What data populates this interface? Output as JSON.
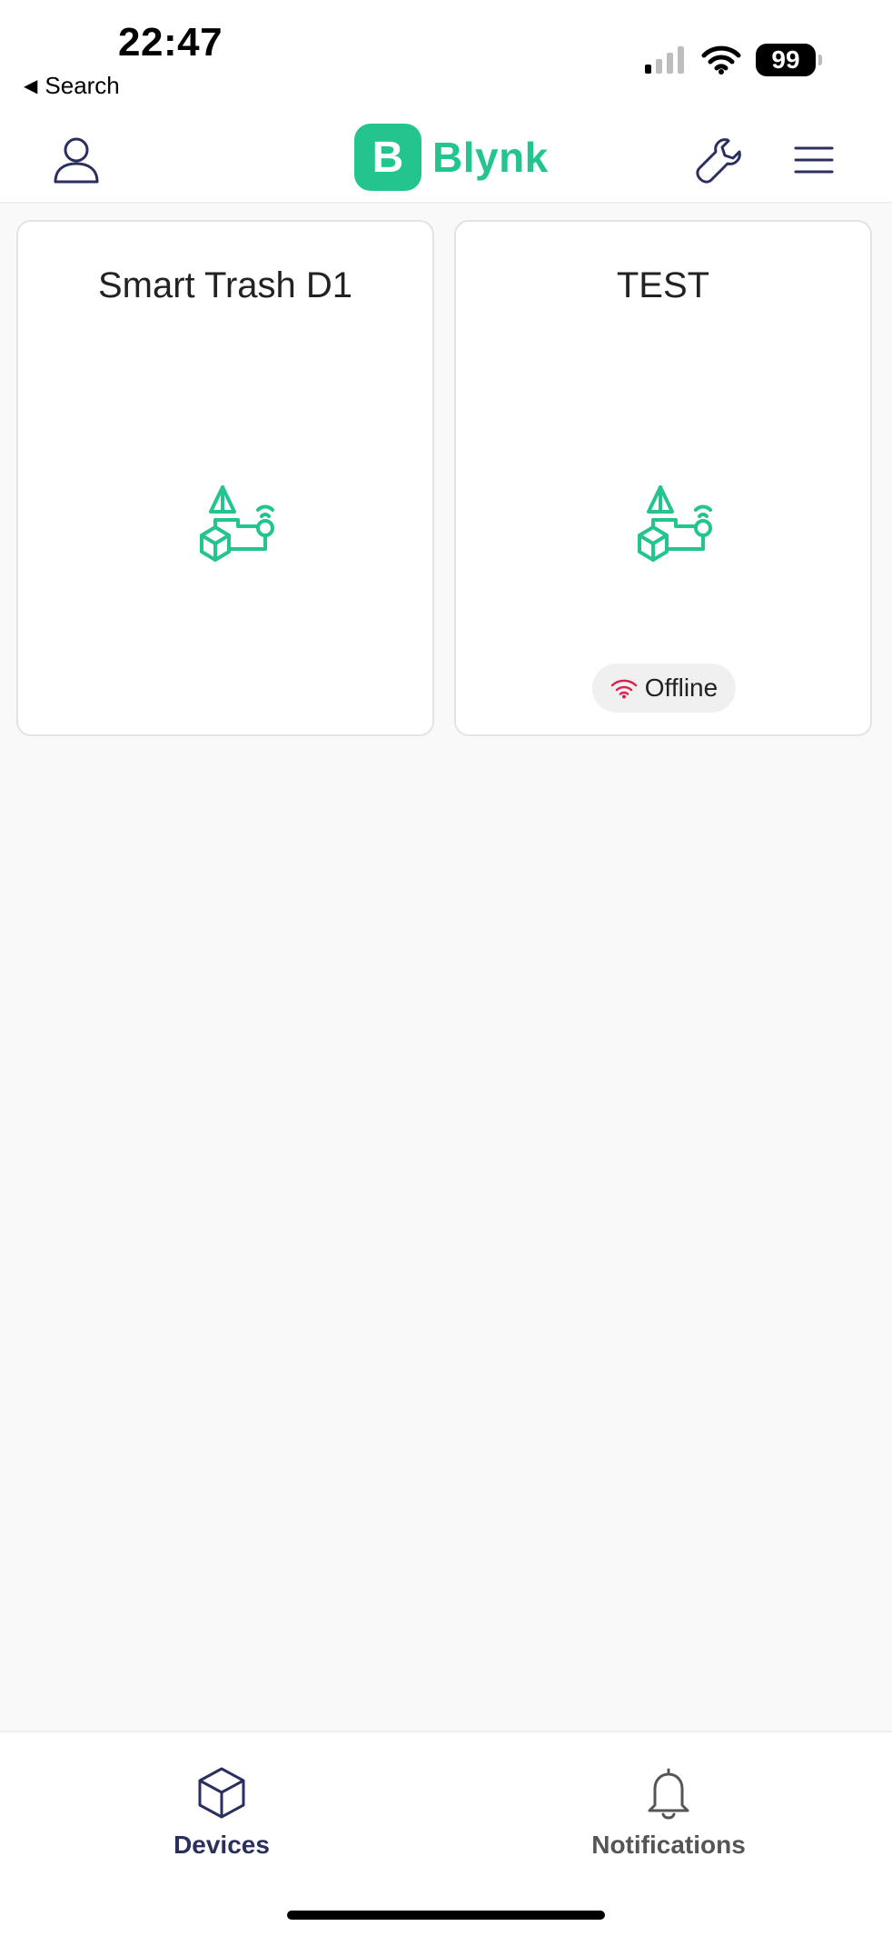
{
  "status_bar": {
    "time": "22:47",
    "back_label": "Search",
    "battery": "99"
  },
  "header": {
    "logo_letter": "B",
    "logo_text": "Blynk",
    "icons": [
      "user-icon",
      "wrench-icon",
      "menu-icon"
    ]
  },
  "devices": [
    {
      "name": "Smart Trash  D1",
      "icon": "device-template-icon",
      "status": ""
    },
    {
      "name": "TEST",
      "icon": "device-template-icon",
      "status": "Offline"
    }
  ],
  "tabs": [
    {
      "label": "Devices",
      "icon": "cube-icon",
      "active": true
    },
    {
      "label": "Notifications",
      "icon": "bell-icon",
      "active": false
    }
  ],
  "colors": {
    "brand": "#23c48e",
    "nav_active": "#2b2f5e",
    "nav_inactive": "#555555",
    "offline": "#d6234f"
  }
}
